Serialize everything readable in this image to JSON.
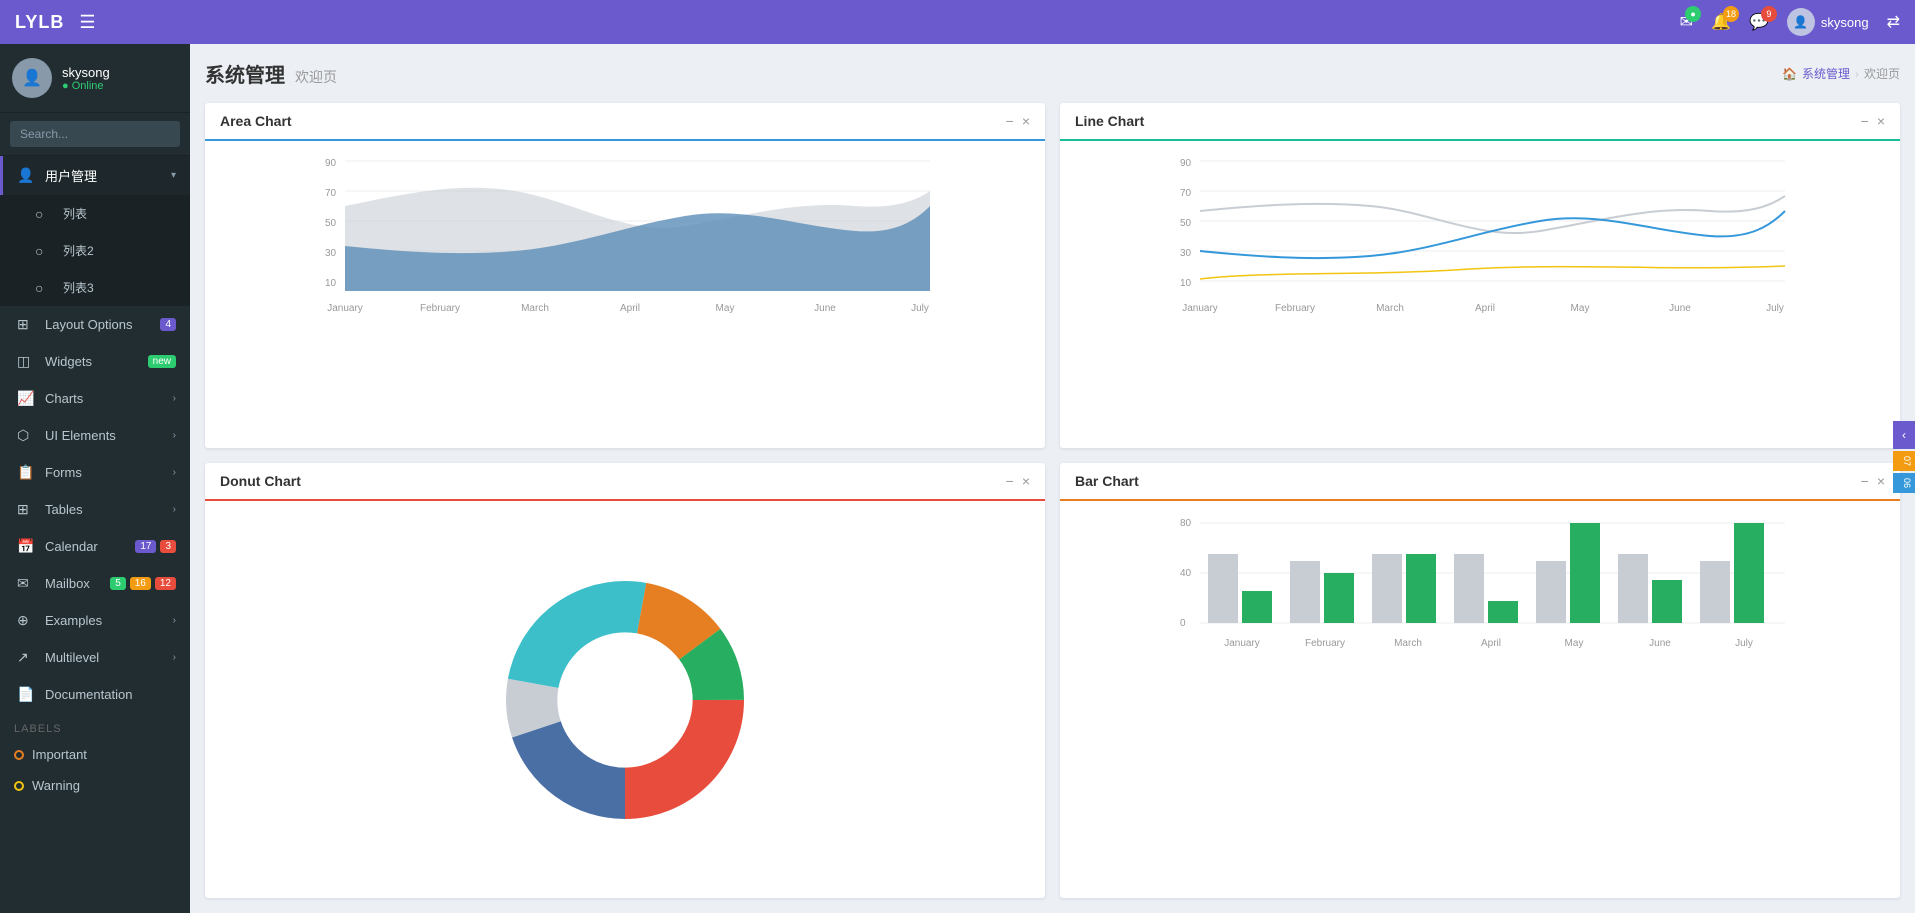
{
  "brand": "LYLB",
  "navbar": {
    "toggle_icon": "☰",
    "mail_badge": "",
    "bell_badge": "18",
    "chat_badge": "9",
    "username": "skysong",
    "share_icon": "⇄"
  },
  "sidebar": {
    "username": "skysong",
    "status": "Online",
    "search_placeholder": "Search...",
    "items": [
      {
        "id": "user-mgmt",
        "icon": "👤",
        "label": "用户管理",
        "has_chevron": true,
        "expanded": true
      },
      {
        "id": "list1",
        "icon": "",
        "label": "列表",
        "sub": true
      },
      {
        "id": "list2",
        "icon": "",
        "label": "列表2",
        "sub": true
      },
      {
        "id": "list3",
        "icon": "",
        "label": "列表3",
        "sub": true
      },
      {
        "id": "layout",
        "icon": "⊞",
        "label": "Layout Options",
        "badge": "4",
        "badge_color": "purple"
      },
      {
        "id": "widgets",
        "icon": "◫",
        "label": "Widgets",
        "badge": "new",
        "badge_color": "green"
      },
      {
        "id": "charts",
        "icon": "📈",
        "label": "Charts",
        "has_chevron": true
      },
      {
        "id": "ui-elements",
        "icon": "⬡",
        "label": "UI Elements",
        "has_chevron": true
      },
      {
        "id": "forms",
        "icon": "📋",
        "label": "Forms",
        "has_chevron": true
      },
      {
        "id": "tables",
        "icon": "⊞",
        "label": "Tables",
        "has_chevron": true
      },
      {
        "id": "calendar",
        "icon": "📅",
        "label": "Calendar",
        "badge": "17",
        "badge2": "3",
        "badge_color": "purple",
        "badge2_color": "red"
      },
      {
        "id": "mailbox",
        "icon": "✉",
        "label": "Mailbox",
        "badge": "5",
        "badge2": "16",
        "badge3": "12",
        "badge_color": "green",
        "badge2_color": "yellow",
        "badge3_color": "red"
      },
      {
        "id": "examples",
        "icon": "⊕",
        "label": "Examples",
        "has_chevron": true
      },
      {
        "id": "multilevel",
        "icon": "↗",
        "label": "Multilevel",
        "has_chevron": true
      },
      {
        "id": "documentation",
        "icon": "📄",
        "label": "Documentation"
      }
    ],
    "labels_section": "LABELS",
    "labels": [
      {
        "id": "important",
        "label": "Important",
        "color": "orange"
      },
      {
        "id": "warning",
        "label": "Warning",
        "color": "yellow"
      }
    ]
  },
  "page": {
    "title": "系统管理",
    "subtitle": "欢迎页",
    "breadcrumb_home": "系统管理",
    "breadcrumb_current": "欢迎页"
  },
  "charts": {
    "area": {
      "title": "Area Chart",
      "x_labels": [
        "January",
        "February",
        "March",
        "April",
        "May",
        "June",
        "July"
      ],
      "y_labels": [
        "90",
        "70",
        "50",
        "30",
        "10"
      ],
      "minus": "−",
      "close": "×"
    },
    "line": {
      "title": "Line Chart",
      "x_labels": [
        "January",
        "February",
        "March",
        "April",
        "May",
        "June",
        "July"
      ],
      "y_labels": [
        "90",
        "70",
        "50",
        "30",
        "10"
      ],
      "minus": "−",
      "close": "×"
    },
    "donut": {
      "title": "Donut Chart",
      "minus": "−",
      "close": "×"
    },
    "bar": {
      "title": "Bar Chart",
      "x_labels": [
        "January",
        "February",
        "March",
        "April",
        "May",
        "June",
        "July"
      ],
      "y_labels": [
        "80",
        "40",
        "0"
      ],
      "minus": "−",
      "close": "×"
    }
  },
  "right_panel": {
    "tabs": [
      "07",
      "06"
    ]
  }
}
